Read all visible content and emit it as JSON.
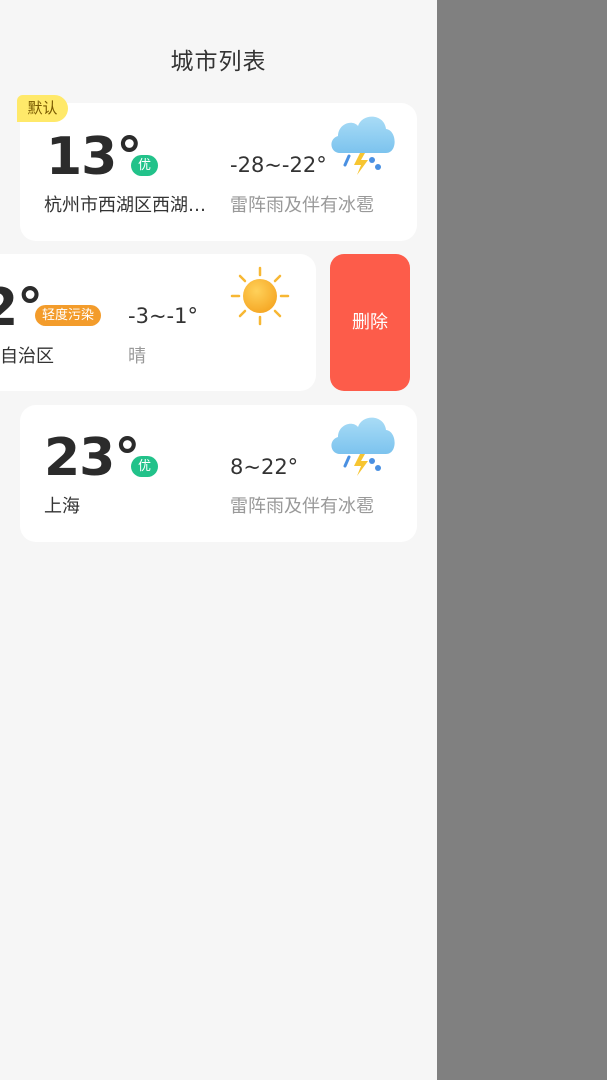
{
  "header": {
    "title": "城市列表"
  },
  "cards": [
    {
      "default_tag": "默认",
      "temperature": "13°",
      "aqi": "优",
      "city": "杭州市西湖区西湖…",
      "range": "-28~-22°",
      "condition": "雷阵雨及伴有冰雹",
      "icon": "thunderstorm-hail-icon"
    },
    {
      "temperature": "2°",
      "aqi": "轻度污染",
      "city": "自治区",
      "range": "-3~-1°",
      "condition": "晴",
      "icon": "sun-icon"
    },
    {
      "temperature": "23°",
      "aqi": "优",
      "city": "上海",
      "range": "8~22°",
      "condition": "雷阵雨及伴有冰雹",
      "icon": "thunderstorm-hail-icon"
    }
  ],
  "actions": {
    "delete_label": "删除"
  },
  "colors": {
    "aqi_good": "#22c28a",
    "aqi_light_pollution": "#f39c2b",
    "delete": "#fd5c4a",
    "default_tag": "#ffe96a",
    "overlay": "#808080"
  }
}
